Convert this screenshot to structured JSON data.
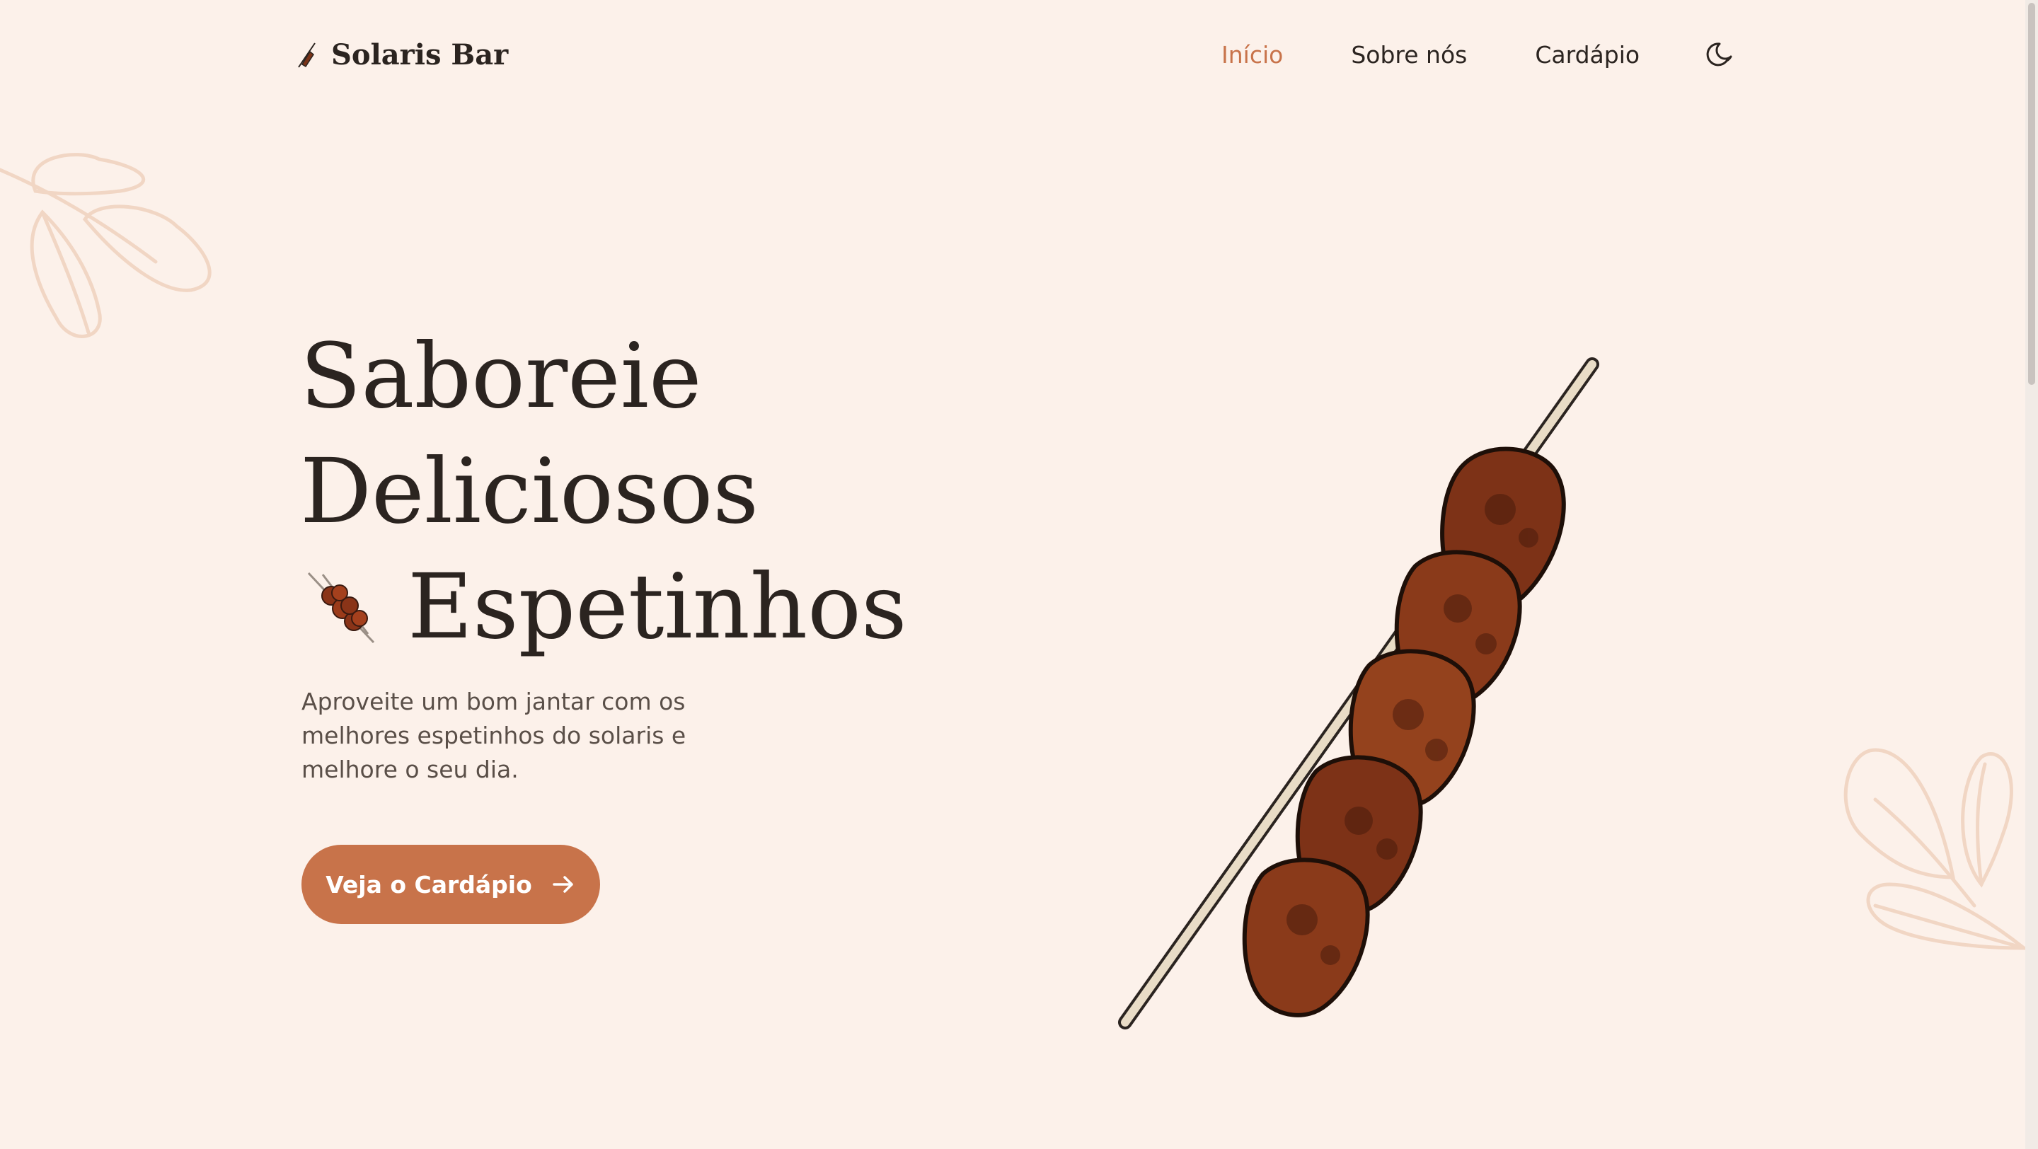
{
  "header": {
    "brand_name": "Solaris Bar",
    "nav": {
      "home": "Início",
      "about": "Sobre nós",
      "menu": "Cardápio"
    },
    "theme_icon": "moon-icon"
  },
  "hero": {
    "title_line1": "Saboreie",
    "title_line2": "Deliciosos",
    "title_line3": "Espetinhos",
    "description": "Aproveite um bom jantar com os melhores espetinhos do solaris e melhore o seu dia.",
    "cta_label": "Veja o Cardápio",
    "cta_icon": "arrow-right-icon"
  },
  "colors": {
    "background": "#fcf1ea",
    "accent": "#c8734a",
    "text": "#2b2420",
    "muted_text": "#5a4f48",
    "leaf": "#f1d6c4"
  }
}
